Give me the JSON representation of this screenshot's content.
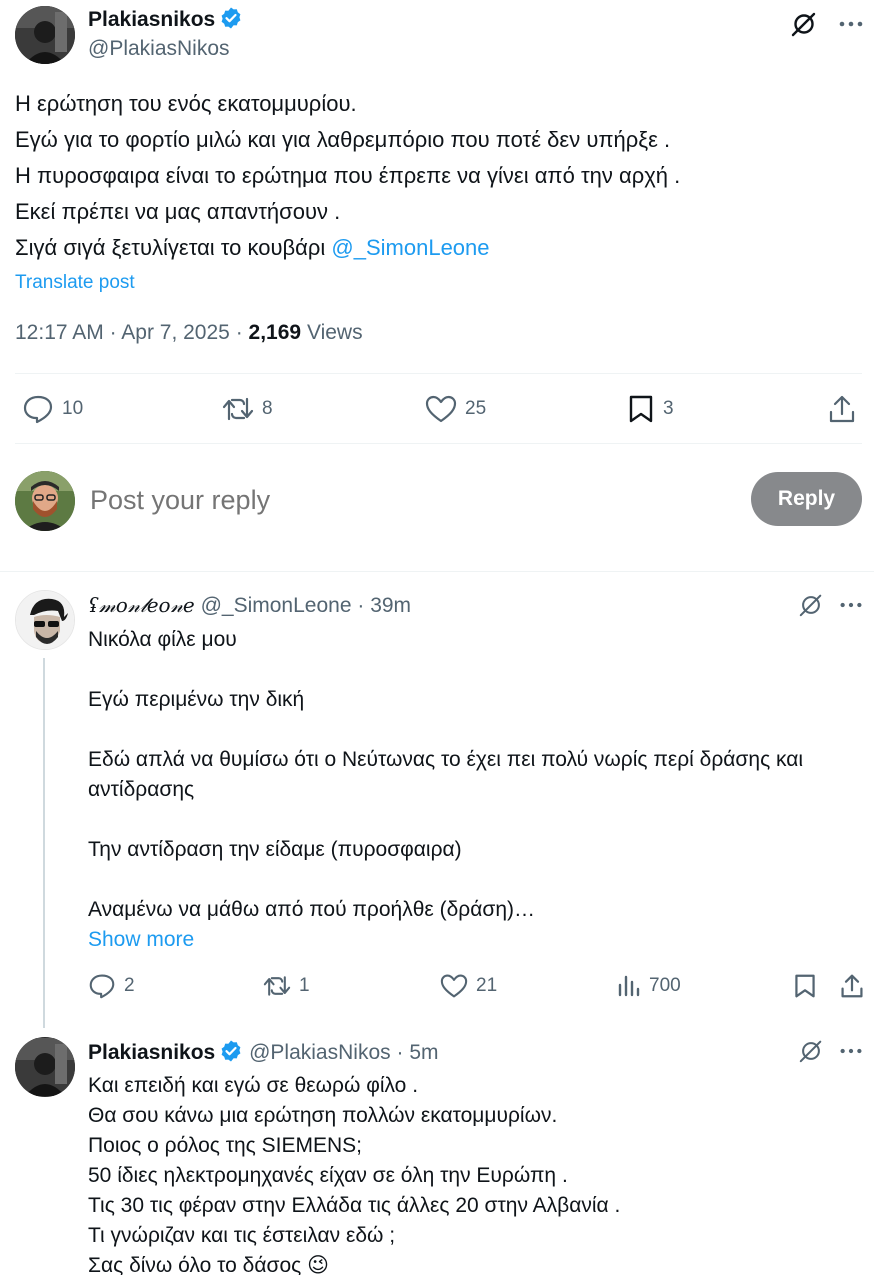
{
  "main_tweet": {
    "author_name": "Plakiasnikos",
    "author_handle": "@PlakiasNikos",
    "lines": [
      "Η ερώτηση του ενός εκατομμυρίου.",
      "Εγώ για το φορτίο μιλώ και για λαθρεμπόριο που ποτέ δεν υπήρξε .",
      "Η πυροσφαιρα είναι το ερώτημα που έπρεπε να γίνει από την αρχή .",
      "Εκεί πρέπει να μας απαντήσουν ."
    ],
    "last_line_prefix": "Σιγά σιγά ξετυλίγεται το κουβάρι ",
    "mention": "@_SimonLeone",
    "translate_label": "Translate post",
    "time": "12:17 AM",
    "date": "Apr 7, 2025",
    "views_count": "2,169",
    "views_label": "Views",
    "sep": "·",
    "actions": {
      "replies": "10",
      "reposts": "8",
      "likes": "25",
      "bookmarks": "3"
    }
  },
  "reply_composer": {
    "placeholder": "Post your reply",
    "button_label": "Reply"
  },
  "replies": [
    {
      "author_name": "ʢ𝓂𝑜𝓃𝓁𝑒𝑜𝓃𝑒",
      "author_handle": "@_SimonLeone",
      "time": "39m",
      "sep": "·",
      "paragraphs": [
        "Νικόλα φίλε μου",
        "Εγώ περιμένω την δική",
        "Εδώ απλά να θυμίσω ότι ο Νεύτωνας το έχει πει πολύ νωρίς περί δράσης και αντίδρασης",
        "Την αντίδραση την είδαμε (πυροσφαιρα)",
        "Αναμένω να μάθω από πού προήλθε (δράση)…"
      ],
      "show_more": "Show more",
      "actions": {
        "replies": "2",
        "reposts": "1",
        "likes": "21",
        "views": "700"
      }
    },
    {
      "author_name": "Plakiasnikos",
      "author_handle": "@PlakiasNikos",
      "time": "5m",
      "sep": "·",
      "lines": [
        "Και επειδή και εγώ σε θεωρώ φίλο .",
        "Θα σου κάνω μια ερώτηση πολλών εκατομμυρίων.",
        "Ποιος ο ρόλος της SIEMENS;",
        "50 ίδιες ηλεκτρομηχανές είχαν σε όλη την Ευρώπη .",
        "Τις 30 τις φέραν στην Ελλάδα τις άλλες 20 στην Αλβανία .",
        "Τι γνώριζαν και τις έστειλαν εδώ ;",
        "Σας δίνω όλο το δάσος"
      ],
      "emoji": "😉"
    }
  ],
  "colors": {
    "accent": "#1d9bf0",
    "text": "#0f1419",
    "muted": "#536471",
    "divider": "#eff3f4",
    "reply_button": "#87898c"
  }
}
